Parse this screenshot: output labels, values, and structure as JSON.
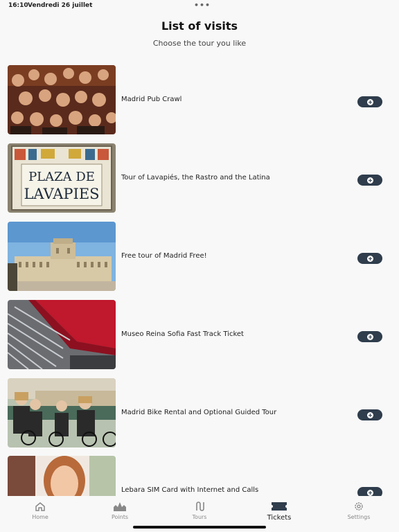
{
  "status": {
    "time": "16:10",
    "date": "Vendredi 26 juillet"
  },
  "header": {
    "title": "List of visits",
    "subtitle": "Choose the tour you like"
  },
  "visits": [
    {
      "title": "Madrid Pub Crawl"
    },
    {
      "title": "Tour of Lavapiés, the Rastro and the Latina"
    },
    {
      "title": "Free tour of Madrid Free!"
    },
    {
      "title": "Museo Reina Sofia Fast Track Ticket"
    },
    {
      "title": "Madrid Bike Rental and Optional Guided Tour"
    },
    {
      "title": "Lebara SIM Card with Internet and Calls"
    }
  ],
  "sign": {
    "line1": "PLAZA DE",
    "line2": "LAVAPIES"
  },
  "tabs": [
    {
      "label": "Home",
      "icon": "home-icon"
    },
    {
      "label": "Points",
      "icon": "landmark-icon"
    },
    {
      "label": "Tours",
      "icon": "route-icon"
    },
    {
      "label": "Tickets",
      "icon": "ticket-icon",
      "active": true
    },
    {
      "label": "Settings",
      "icon": "gear-icon"
    }
  ],
  "colors": {
    "accent": "#2f3d4c",
    "background": "#f8f8f8",
    "text": "#222222"
  }
}
